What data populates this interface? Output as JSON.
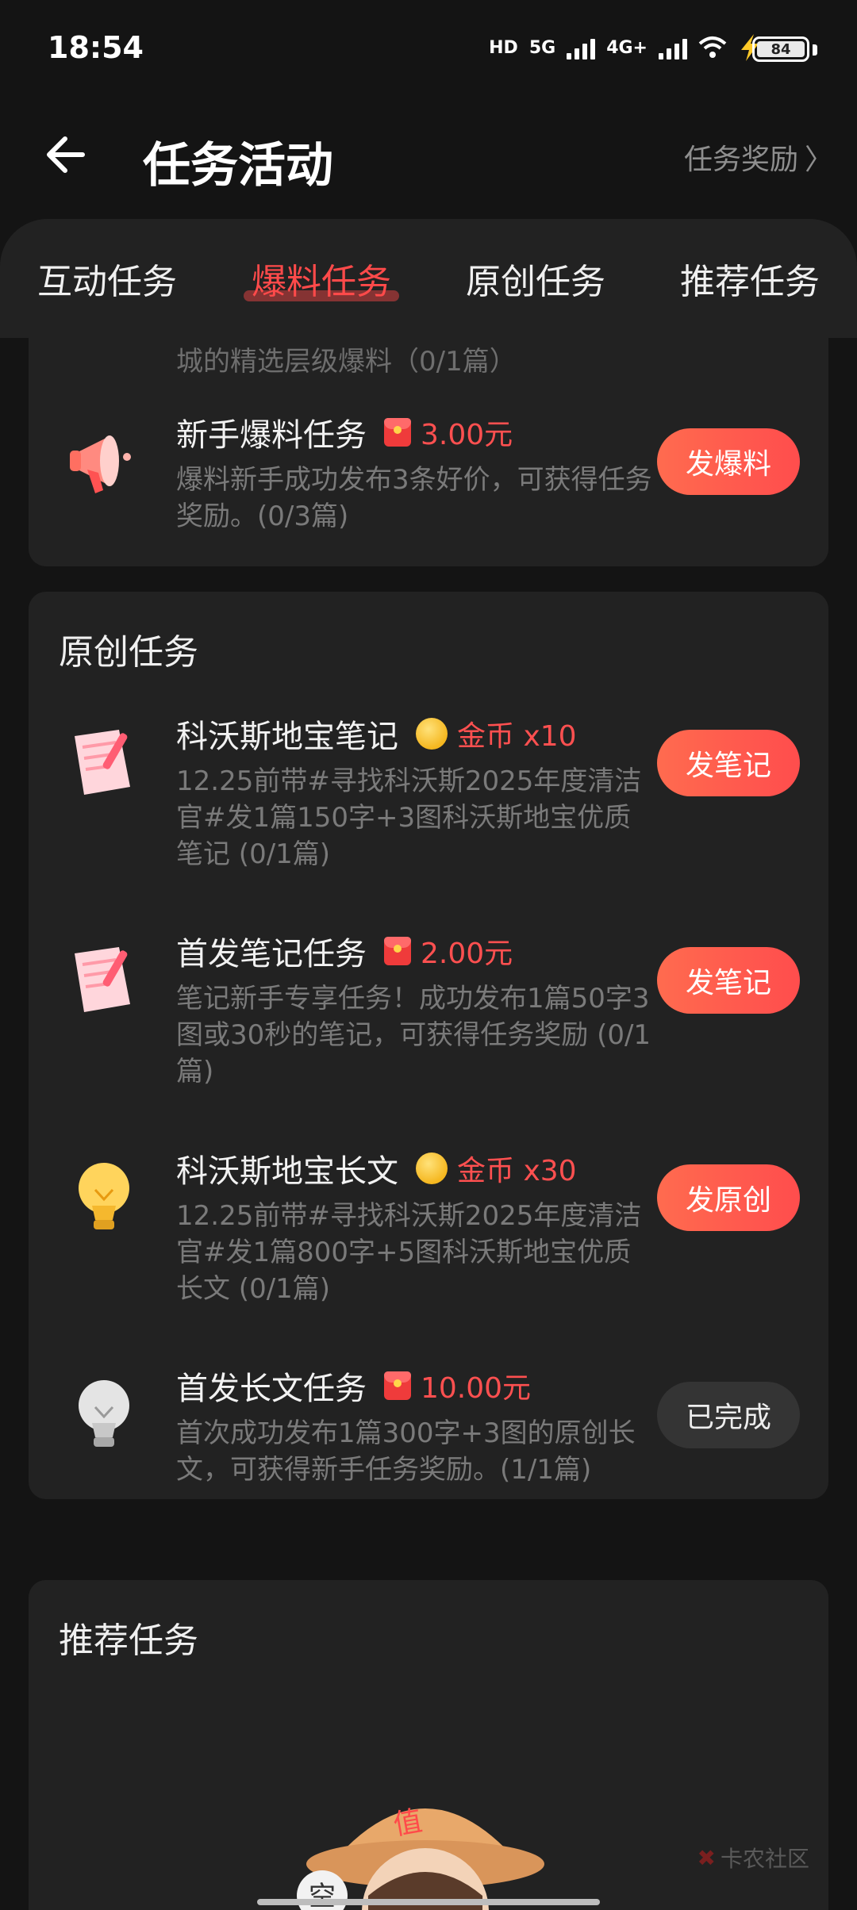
{
  "status_bar": {
    "time": "18:54",
    "network_hd": "HD",
    "network_5g": "5G",
    "network_4g": "4G+",
    "battery": "84"
  },
  "header": {
    "back_icon": "arrow-left-icon",
    "title": "任务活动",
    "reward_link": "任务奖励",
    "reward_chevron": "〉"
  },
  "tabs": [
    {
      "label": "互动任务",
      "active": false
    },
    {
      "label": "爆料任务",
      "active": true
    },
    {
      "label": "原创任务",
      "active": false
    },
    {
      "label": "推荐任务",
      "active": false
    }
  ],
  "baoliao_section": {
    "clipped_text": "城的精选层级爆料（0/1篇）",
    "tasks": [
      {
        "name": "新手爆料任务",
        "reward_type": "envelope",
        "reward": "3.00元",
        "description": "爆料新手成功发布3条好价，可获得任务奖励。(0/3篇)",
        "button": "发爆料",
        "icon": "megaphone-icon"
      }
    ]
  },
  "original_section": {
    "title": "原创任务",
    "tasks": [
      {
        "name": "科沃斯地宝笔记",
        "reward_type": "coin",
        "reward": "金币 x10",
        "description": "12.25前带#寻找科沃斯2025年度清洁官#发1篇150字+3图科沃斯地宝优质笔记 (0/1篇)",
        "button": "发笔记",
        "icon": "note-scroll-icon"
      },
      {
        "name": "首发笔记任务",
        "reward_type": "envelope",
        "reward": "2.00元",
        "description": "笔记新手专享任务！成功发布1篇50字3图或30秒的笔记，可获得任务奖励 (0/1篇)",
        "button": "发笔记",
        "icon": "note-scroll-icon"
      },
      {
        "name": "科沃斯地宝长文",
        "reward_type": "coin",
        "reward": "金币 x30",
        "description": "12.25前带#寻找科沃斯2025年度清洁官#发1篇800字+5图科沃斯地宝优质长文 (0/1篇)",
        "button": "发原创",
        "icon": "lightbulb-icon"
      },
      {
        "name": "首发长文任务",
        "reward_type": "envelope",
        "reward": "10.00元",
        "description": "首次成功发布1篇300字+3图的原创长文，可获得新手任务奖励。(1/1篇)",
        "button": "已完成",
        "done": true,
        "icon": "lightbulb-gray-icon"
      }
    ]
  },
  "recommend_section": {
    "title": "推荐任务",
    "empty_badge": "值",
    "empty_bubble": "空"
  },
  "watermark": "卡农社区"
}
